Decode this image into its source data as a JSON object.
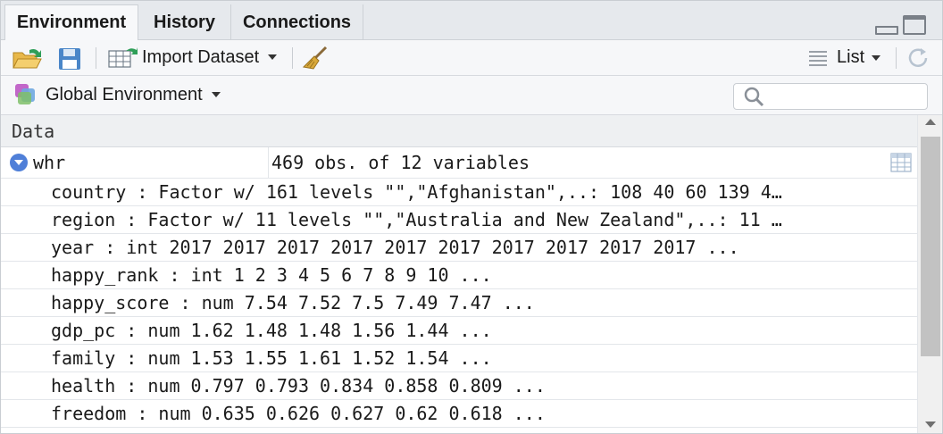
{
  "tabs": [
    {
      "label": "Environment",
      "active": true
    },
    {
      "label": "History",
      "active": false
    },
    {
      "label": "Connections",
      "active": false
    }
  ],
  "toolbar": {
    "load_icon": "folder-open-icon",
    "save_icon": "floppy-disk-icon",
    "import_label": "Import Dataset",
    "broom_icon": "broom-icon",
    "view_label": "List",
    "refresh_icon": "refresh-icon"
  },
  "env": {
    "label": "Global Environment",
    "search_placeholder": ""
  },
  "data": {
    "section_title": "Data",
    "object": {
      "name": "whr",
      "description": "469 obs. of 12 variables"
    },
    "variables": [
      "country : Factor w/ 161 levels \"\",\"Afghanistan\",..: 108 40 60 139 4…",
      "region : Factor w/ 11 levels \"\",\"Australia and New Zealand\",..: 11 …",
      "year : int 2017 2017 2017 2017 2017 2017 2017 2017 2017 2017 ...",
      "happy_rank : int 1 2 3 4 5 6 7 8 9 10 ...",
      "happy_score : num 7.54 7.52 7.5 7.49 7.47 ...",
      "gdp_pc : num 1.62 1.48 1.48 1.56 1.44 ...",
      "family : num 1.53 1.55 1.61 1.52 1.54 ...",
      "health : num 0.797 0.793 0.834 0.858 0.809 ...",
      "freedom : num 0.635 0.626 0.627 0.62 0.618 ..."
    ]
  },
  "colors": {
    "accent": "#4f7fd8",
    "tabbar_bg": "#e6e9ed",
    "toolbar_bg": "#f6f7f9"
  }
}
